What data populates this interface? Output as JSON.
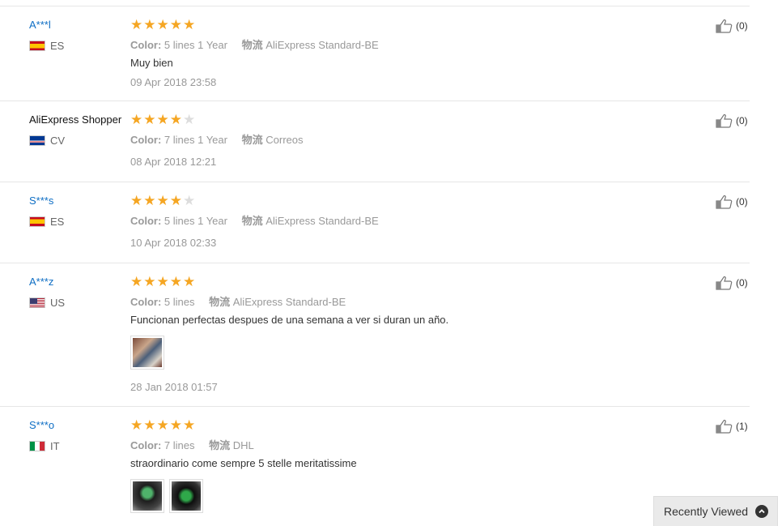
{
  "reviews": [
    {
      "user": "A***l",
      "country": "ES",
      "stars": 5,
      "color_label": "Color:",
      "color_value": "5 lines 1 Year",
      "ship_label": "物流",
      "ship_value": "AliExpress Standard-BE",
      "text": "Muy bien",
      "date": "09 Apr 2018 23:58",
      "helpful": "(0)"
    },
    {
      "user": "AliExpress Shopper",
      "country": "CV",
      "stars": 4,
      "color_label": "Color:",
      "color_value": "7 lines 1 Year",
      "ship_label": "物流",
      "ship_value": "Correos",
      "text": "",
      "date": "08 Apr 2018 12:21",
      "helpful": "(0)"
    },
    {
      "user": "S***s",
      "country": "ES",
      "stars": 4,
      "color_label": "Color:",
      "color_value": "5 lines 1 Year",
      "ship_label": "物流",
      "ship_value": "AliExpress Standard-BE",
      "text": "",
      "date": "10 Apr 2018 02:33",
      "helpful": "(0)"
    },
    {
      "user": "A***z",
      "country": "US",
      "stars": 5,
      "color_label": "Color:",
      "color_value": "5 lines",
      "ship_label": "物流",
      "ship_value": "AliExpress Standard-BE",
      "text": "Funcionan perfectas despues de una semana a ver si duran un año.",
      "date": "28 Jan 2018 01:57",
      "helpful": "(0)"
    },
    {
      "user": "S***o",
      "country": "IT",
      "stars": 5,
      "color_label": "Color:",
      "color_value": "7 lines",
      "ship_label": "物流",
      "ship_value": "DHL",
      "text": "straordinario come sempre 5 stelle meritatissime",
      "date": "",
      "helpful": "(1)"
    }
  ],
  "recently_viewed": {
    "label": "Recently Viewed"
  },
  "colors": {
    "link": "#0e6ec4",
    "star_on": "#f5a623",
    "star_off": "#dddddd",
    "muted": "#999999"
  }
}
